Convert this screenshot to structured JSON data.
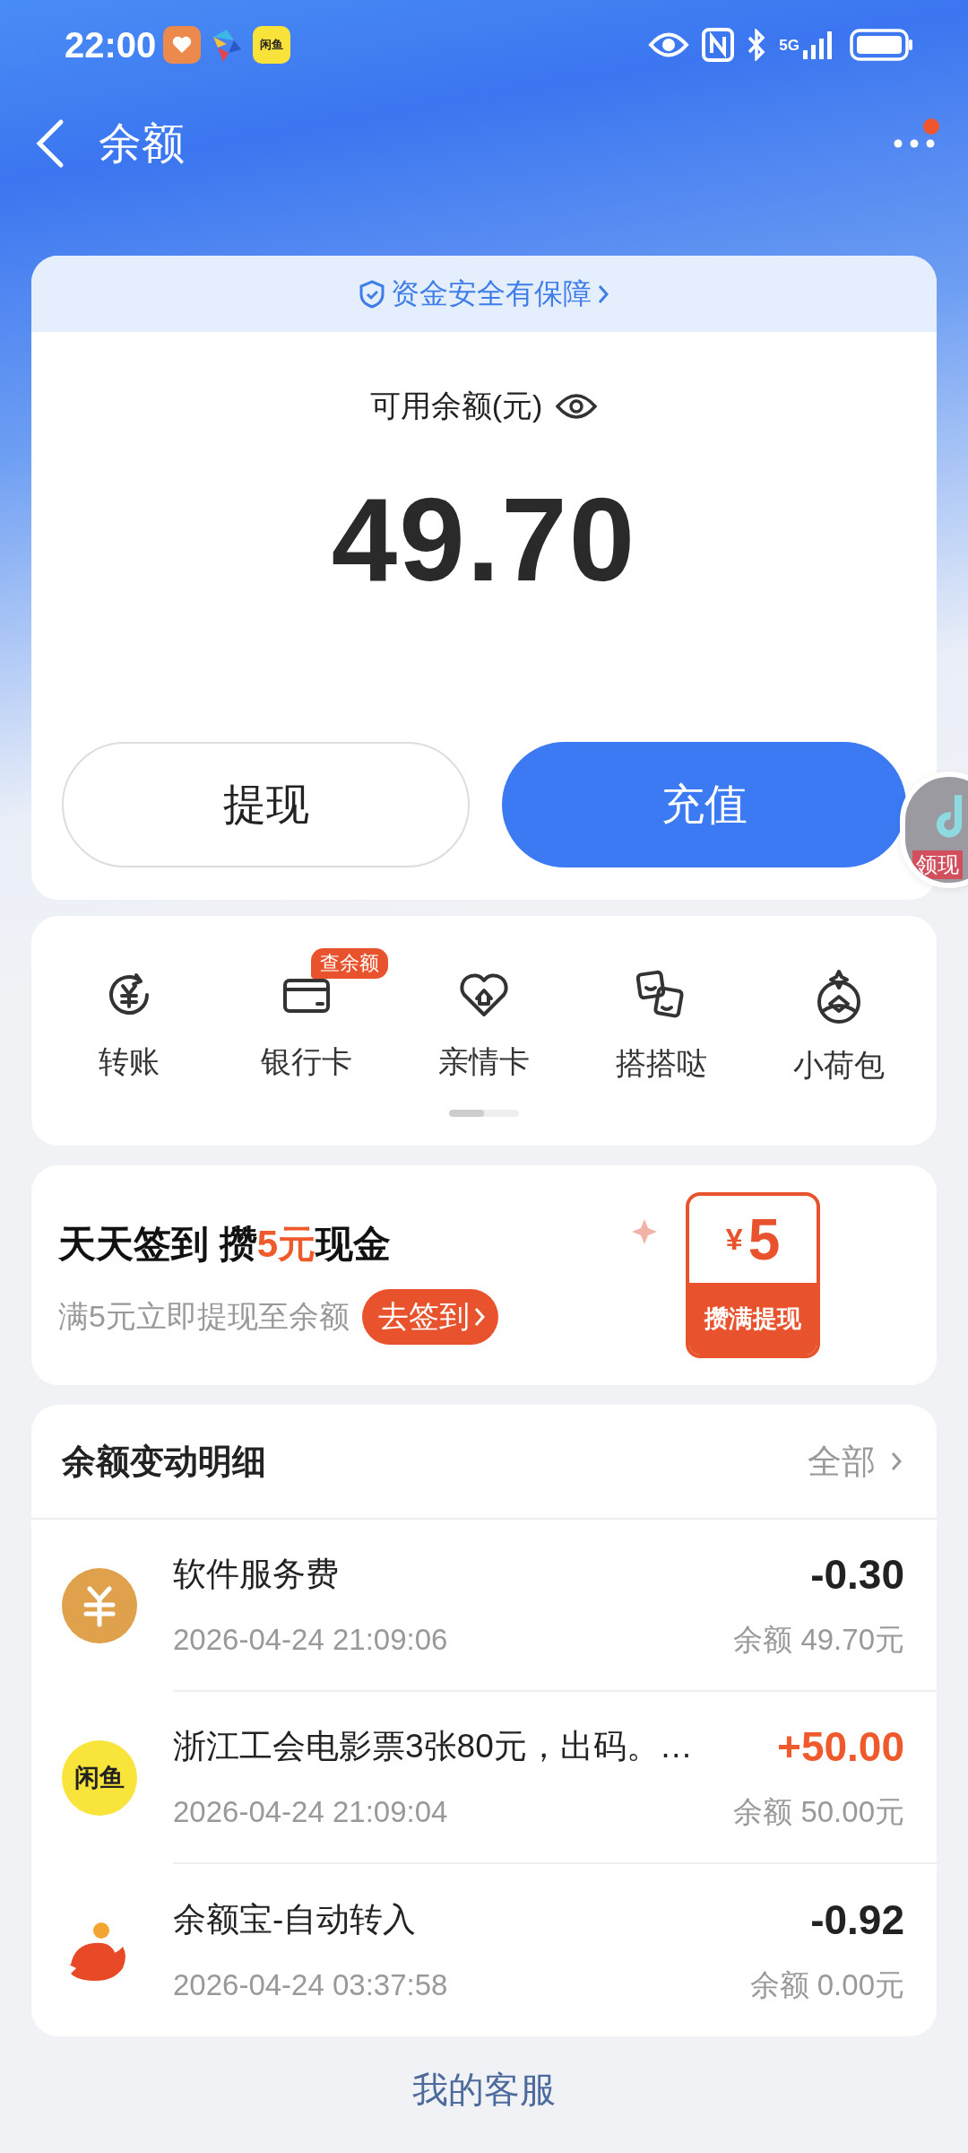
{
  "status_bar": {
    "time": "22:00",
    "network": "5G",
    "notification_badge": "闲鱼"
  },
  "nav": {
    "title": "余额",
    "has_notice": true
  },
  "balance_card": {
    "safety_link": "资金安全有保障",
    "label": "可用余额(元)",
    "amount": "49.70",
    "buttons": [
      {
        "label": "提现",
        "kind": "secondary"
      },
      {
        "label": "充值",
        "kind": "primary"
      }
    ]
  },
  "floating_badge": {
    "text": "领现"
  },
  "services": {
    "items": [
      {
        "label": "转账"
      },
      {
        "label": "银行卡",
        "badge": "查余额"
      },
      {
        "label": "亲情卡"
      },
      {
        "label": "搭搭哒"
      },
      {
        "label": "小荷包"
      }
    ],
    "pager": {
      "level": 0.5
    }
  },
  "promo": {
    "title_parts": [
      {
        "text": "天天签到 攒",
        "highlight": false
      },
      {
        "text": "5元",
        "highlight": true
      },
      {
        "text": "现金",
        "highlight": false
      }
    ],
    "subtitle": "满5元立即提现至余额",
    "button": "去签到",
    "reward": {
      "currency": "¥",
      "amount": "5",
      "caption": "攒满提现"
    }
  },
  "transactions": {
    "title": "余额变动明细",
    "link": "全部",
    "rows": [
      {
        "name": "软件服务费",
        "time": "2026-04-24 21:09:06",
        "amount": "-0.30",
        "kind": "expense",
        "balance": "余额 49.70元"
      },
      {
        "name": "浙江工会电影票3张80元，出码。…",
        "time": "2026-04-24 21:09:04",
        "amount": "+50.00",
        "kind": "income",
        "balance": "余额 50.00元",
        "logo_text": "闲鱼"
      },
      {
        "name": "余额宝-自动转入",
        "time": "2026-04-24 03:37:58",
        "amount": "-0.92",
        "kind": "expense",
        "balance": "余额 0.00元"
      }
    ]
  },
  "footer_link": "我的客服"
}
